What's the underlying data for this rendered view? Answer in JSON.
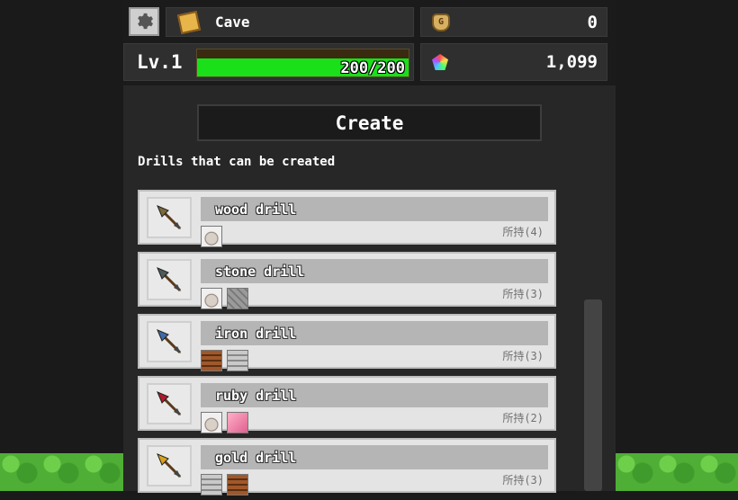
{
  "header": {
    "location": "Cave",
    "gold": "0",
    "level_label": "Lv.1",
    "exp_text": "200/200",
    "exp_fraction": 1.0,
    "gems": "1,099"
  },
  "create_button": "Create",
  "section_title": "Drills that can be created",
  "drills": [
    {
      "name": "wood drill",
      "owned": "所持(4)",
      "color": "#7a6a3a",
      "materials": [
        "rock"
      ]
    },
    {
      "name": "stone drill",
      "owned": "所持(3)",
      "color": "#4f5a5a",
      "materials": [
        "rock",
        "stone"
      ]
    },
    {
      "name": "iron drill",
      "owned": "所持(3)",
      "color": "#3f6aa8",
      "materials": [
        "wood",
        "iron"
      ]
    },
    {
      "name": "ruby drill",
      "owned": "所持(2)",
      "color": "#b01a28",
      "materials": [
        "rock",
        "ruby"
      ]
    },
    {
      "name": "gold drill",
      "owned": "所持(3)",
      "color": "#d8a020",
      "materials": [
        "iron",
        "wood"
      ]
    }
  ]
}
